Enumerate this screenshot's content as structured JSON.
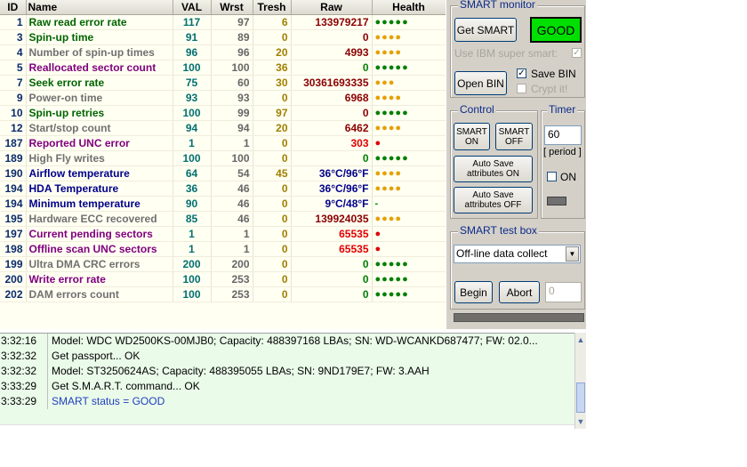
{
  "columns": [
    "ID",
    "Name",
    "VAL",
    "Wrst",
    "Tresh",
    "Raw",
    "Health"
  ],
  "rows": [
    {
      "id": "1",
      "name": "Raw read error rate",
      "val": "117",
      "wrst": "97",
      "tresh": "6",
      "raw": "133979217",
      "health": "●●●●●",
      "name_color": "#006400",
      "raw_color": "#8b0000",
      "health_color": "#008000"
    },
    {
      "id": "3",
      "name": "Spin-up time",
      "val": "91",
      "wrst": "89",
      "tresh": "0",
      "raw": "0",
      "health": "●●●●",
      "name_color": "#006400",
      "raw_color": "#8b0000",
      "health_color": "#e6a000"
    },
    {
      "id": "4",
      "name": "Number of spin-up times",
      "val": "96",
      "wrst": "96",
      "tresh": "20",
      "raw": "4993",
      "health": "●●●●",
      "name_color": "#707070",
      "raw_color": "#8b0000",
      "health_color": "#e6a000"
    },
    {
      "id": "5",
      "name": "Reallocated sector count",
      "val": "100",
      "wrst": "100",
      "tresh": "36",
      "raw": "0",
      "health": "●●●●●",
      "name_color": "#800080",
      "raw_color": "#008000",
      "health_color": "#008000"
    },
    {
      "id": "7",
      "name": "Seek error rate",
      "val": "75",
      "wrst": "60",
      "tresh": "30",
      "raw": "30361693335",
      "health": "●●●",
      "name_color": "#006400",
      "raw_color": "#8b0000",
      "health_color": "#e6a000"
    },
    {
      "id": "9",
      "name": "Power-on time",
      "val": "93",
      "wrst": "93",
      "tresh": "0",
      "raw": "6968",
      "health": "●●●●",
      "name_color": "#707070",
      "raw_color": "#8b0000",
      "health_color": "#e6a000"
    },
    {
      "id": "10",
      "name": "Spin-up retries",
      "val": "100",
      "wrst": "99",
      "tresh": "97",
      "raw": "0",
      "health": "●●●●●",
      "name_color": "#006400",
      "raw_color": "#8b0000",
      "health_color": "#008000"
    },
    {
      "id": "12",
      "name": "Start/stop count",
      "val": "94",
      "wrst": "94",
      "tresh": "20",
      "raw": "6462",
      "health": "●●●●",
      "name_color": "#707070",
      "raw_color": "#8b0000",
      "health_color": "#e6a000"
    },
    {
      "id": "187",
      "name": "Reported UNC error",
      "val": "1",
      "wrst": "1",
      "tresh": "0",
      "raw": "303",
      "health": "●",
      "name_color": "#800080",
      "raw_color": "#e00000",
      "health_color": "#e00000"
    },
    {
      "id": "189",
      "name": "High Fly writes",
      "val": "100",
      "wrst": "100",
      "tresh": "0",
      "raw": "0",
      "health": "●●●●●",
      "name_color": "#707070",
      "raw_color": "#008000",
      "health_color": "#008000"
    },
    {
      "id": "190",
      "name": "Airflow temperature",
      "val": "64",
      "wrst": "54",
      "tresh": "45",
      "raw": "36°C/96°F",
      "health": "●●●●",
      "name_color": "#00008b",
      "raw_color": "#00008b",
      "health_color": "#e6a000"
    },
    {
      "id": "194",
      "name": "HDA Temperature",
      "val": "36",
      "wrst": "46",
      "tresh": "0",
      "raw": "36°C/96°F",
      "health": "●●●●",
      "name_color": "#00008b",
      "raw_color": "#00008b",
      "health_color": "#e6a000"
    },
    {
      "id": "194",
      "name": "Minimum temperature",
      "val": "90",
      "wrst": "46",
      "tresh": "0",
      "raw": "9°C/48°F",
      "health": "-",
      "name_color": "#00008b",
      "raw_color": "#00008b",
      "health_color": "#008000"
    },
    {
      "id": "195",
      "name": "Hardware ECC recovered",
      "val": "85",
      "wrst": "46",
      "tresh": "0",
      "raw": "139924035",
      "health": "●●●●",
      "name_color": "#707070",
      "raw_color": "#8b0000",
      "health_color": "#e6a000"
    },
    {
      "id": "197",
      "name": "Current pending sectors",
      "val": "1",
      "wrst": "1",
      "tresh": "0",
      "raw": "65535",
      "health": "●",
      "name_color": "#800080",
      "raw_color": "#e00000",
      "health_color": "#e00000"
    },
    {
      "id": "198",
      "name": "Offline scan UNC sectors",
      "val": "1",
      "wrst": "1",
      "tresh": "0",
      "raw": "65535",
      "health": "●",
      "name_color": "#800080",
      "raw_color": "#e00000",
      "health_color": "#e00000"
    },
    {
      "id": "199",
      "name": "Ultra DMA CRC errors",
      "val": "200",
      "wrst": "200",
      "tresh": "0",
      "raw": "0",
      "health": "●●●●●",
      "name_color": "#707070",
      "raw_color": "#008000",
      "health_color": "#008000"
    },
    {
      "id": "200",
      "name": "Write error rate",
      "val": "100",
      "wrst": "253",
      "tresh": "0",
      "raw": "0",
      "health": "●●●●●",
      "name_color": "#800080",
      "raw_color": "#008000",
      "health_color": "#008000"
    },
    {
      "id": "202",
      "name": "DAM errors count",
      "val": "100",
      "wrst": "253",
      "tresh": "0",
      "raw": "0",
      "health": "●●●●●",
      "name_color": "#707070",
      "raw_color": "#008000",
      "health_color": "#008000"
    }
  ],
  "smart_monitor": {
    "title": "SMART monitor",
    "get_smart_label": "Get SMART",
    "status_label": "GOOD",
    "status_color": "#00e000",
    "ibm_label": "Use IBM super smart:",
    "open_bin_label": "Open BIN",
    "save_bin_label": "Save BIN",
    "crypt_label": "Crypt it!"
  },
  "control": {
    "title": "Control",
    "smart_on_label": "SMART ON",
    "smart_off_label": "SMART OFF",
    "autosave_on_label": "Auto Save attributes ON",
    "autosave_off_label": "Auto Save attributes OFF"
  },
  "timer": {
    "title": "Timer",
    "period_value": "60",
    "period_label": "[ period ]",
    "on_label": "ON"
  },
  "test_box": {
    "title": "SMART test box",
    "selected": "Off-line data collect",
    "begin_label": "Begin",
    "abort_label": "Abort",
    "progress_value": "0"
  },
  "log": [
    {
      "time": "3:32:16",
      "msg": "Model: WDC WD2500KS-00MJB0; Capacity: 488397168 LBAs; SN: WD-WCANKD687477; FW: 02.0...",
      "color": "#000000"
    },
    {
      "time": "3:32:32",
      "msg": "Get passport... OK",
      "color": "#000000"
    },
    {
      "time": "3:32:32",
      "msg": "Model: ST3250624AS; Capacity: 488395055 LBAs; SN: 9ND179E7; FW: 3.AAH",
      "color": "#000000"
    },
    {
      "time": "3:33:29",
      "msg": "Get S.M.A.R.T. command... OK",
      "color": "#000000"
    },
    {
      "time": "3:33:29",
      "msg": "SMART status = GOOD",
      "color": "#1f3fbf"
    }
  ]
}
